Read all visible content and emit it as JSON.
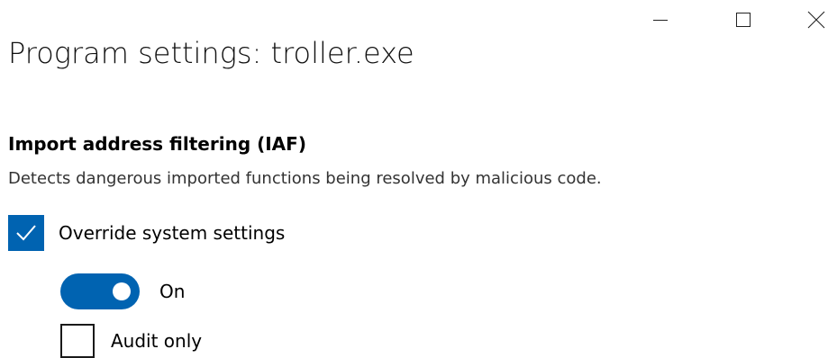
{
  "window": {
    "minimize_icon": "minimize-icon",
    "maximize_icon": "maximize-icon",
    "close_icon": "close-icon"
  },
  "page": {
    "title": "Program settings: troller.exe"
  },
  "section": {
    "title": "Import address filtering (IAF)",
    "description": "Detects dangerous imported functions being resolved by malicious code."
  },
  "override": {
    "label": "Override system settings",
    "checked": true
  },
  "toggle": {
    "label": "On",
    "state": true
  },
  "audit": {
    "label": "Audit only",
    "checked": false
  },
  "colors": {
    "accent": "#0063b1",
    "text": "#000000",
    "background": "#ffffff"
  }
}
